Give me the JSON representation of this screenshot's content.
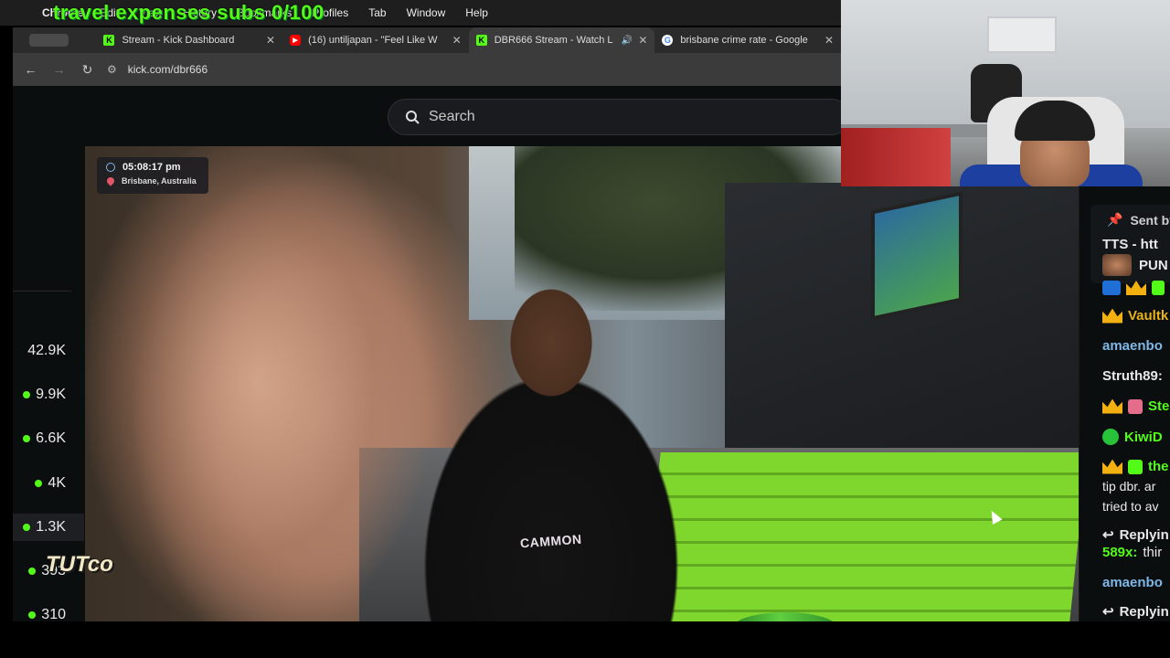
{
  "menubar": {
    "app_name": "Chrome",
    "items": [
      "Edit",
      "View",
      "History",
      "Bookmarks",
      "Profiles",
      "Tab",
      "Window",
      "Help"
    ],
    "overlay_goal": "travel expenses subs 0/100"
  },
  "tabs": [
    {
      "title": "Stream - Kick Dashboard",
      "favicon": "kick-icon",
      "active": false
    },
    {
      "title": "(16) untiljapan - \"Feel Like W",
      "favicon": "youtube-icon",
      "active": false
    },
    {
      "title": "DBR666 Stream - Watch L",
      "favicon": "kick-icon",
      "active": true,
      "audio": true
    },
    {
      "title": "brisbane crime rate - Google",
      "favicon": "google-icon",
      "active": false
    }
  ],
  "address": {
    "url": "kick.com/dbr666"
  },
  "search": {
    "placeholder": "Search"
  },
  "left_rail": {
    "viewers": [
      {
        "count": "42.9K",
        "live": false
      },
      {
        "count": "9.9K",
        "live": true
      },
      {
        "count": "6.6K",
        "live": true
      },
      {
        "count": "4K",
        "live": true
      },
      {
        "count": "1.3K",
        "live": true
      },
      {
        "count": "393",
        "live": true
      },
      {
        "count": "310",
        "live": true
      }
    ]
  },
  "stream": {
    "time": "05:08:17 pm",
    "location": "Brisbane, Australia",
    "shirt_text": "CAMMON",
    "watermark": "TUTco"
  },
  "chat": {
    "pinned_label": "Sent by",
    "pinned_tts": "TTS - htt",
    "pinned_user": "PUN",
    "messages": [
      {
        "user": "Vaultk",
        "badge": "crown"
      },
      {
        "user": "amaenbo",
        "badge": ""
      },
      {
        "user": "Struth89:",
        "badge": ""
      },
      {
        "user": "Ste",
        "badge": "crown-gift"
      },
      {
        "user": "KiwiD",
        "badge": "verified"
      },
      {
        "user": "the",
        "badge": "crown-sub"
      },
      {
        "text": "tip dbr. ar"
      },
      {
        "text": "tried to av"
      },
      {
        "reply": "Replyin"
      },
      {
        "user": "589x:",
        "text": "thir"
      },
      {
        "user": "amaenbo",
        "badge": ""
      },
      {
        "reply": "Replyin"
      }
    ]
  },
  "colors": {
    "kick_green": "#53fc18",
    "crown_gold": "#f2b111"
  }
}
